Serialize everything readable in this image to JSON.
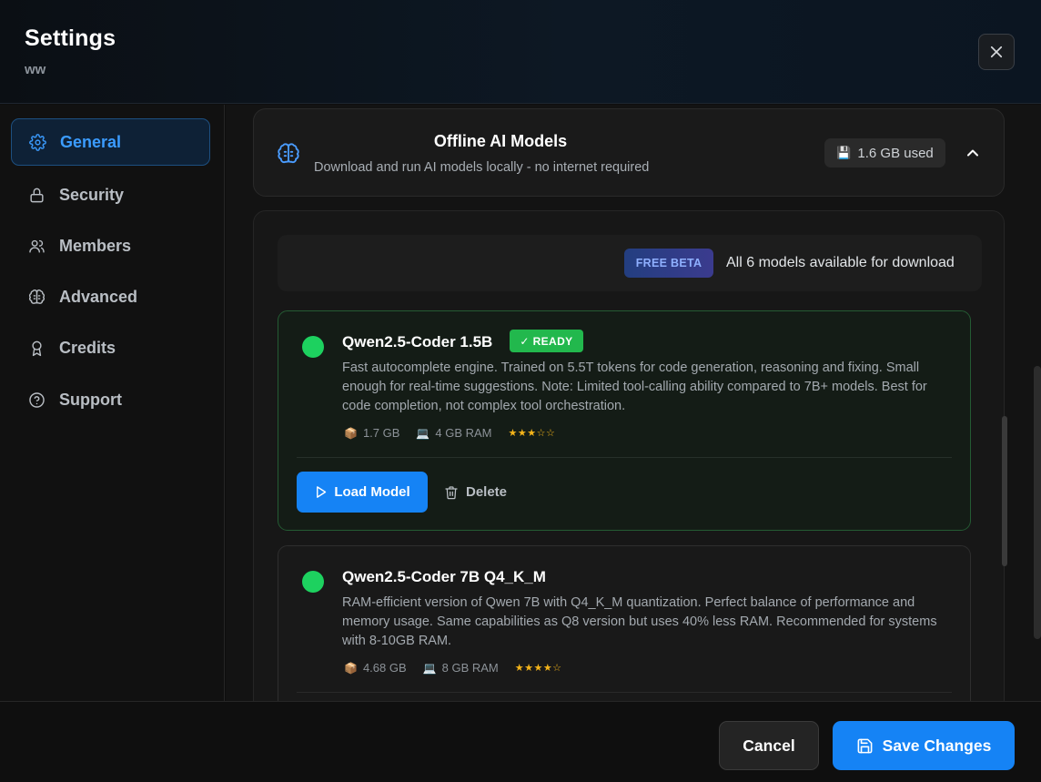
{
  "header": {
    "title": "Settings",
    "subtitle": "ww"
  },
  "sidebar": {
    "items": [
      {
        "label": "General",
        "icon": "gear-icon",
        "active": true
      },
      {
        "label": "Security",
        "icon": "lock-icon",
        "active": false
      },
      {
        "label": "Members",
        "icon": "users-icon",
        "active": false
      },
      {
        "label": "Advanced",
        "icon": "brain-icon",
        "active": false
      },
      {
        "label": "Credits",
        "icon": "award-icon",
        "active": false
      },
      {
        "label": "Support",
        "icon": "help-circle-icon",
        "active": false
      }
    ]
  },
  "section": {
    "title": "Offline AI Models",
    "description": "Download and run AI models locally - no internet required",
    "usage": "1.6 GB used",
    "icon": "brain-icon"
  },
  "info_bar": {
    "badge": "FREE BETA",
    "text": "All 6 models available for download"
  },
  "models": [
    {
      "name": "Qwen2.5-Coder 1.5B",
      "status_badge": "✓ READY",
      "description": "Fast autocomplete engine. Trained on 5.5T tokens for code generation, reasoning and fixing. Small enough for real-time suggestions. Note: Limited tool-calling ability compared to 7B+ models. Best for code completion, not complex tool orchestration.",
      "size": "1.7 GB",
      "ram": "4 GB RAM",
      "stars": "★★★☆☆",
      "rating": 3,
      "load_label": "Load Model",
      "delete_label": "Delete"
    },
    {
      "name": "Qwen2.5-Coder 7B Q4_K_M",
      "description": "RAM-efficient version of Qwen 7B with Q4_K_M quantization. Perfect balance of performance and memory usage. Same capabilities as Q8 version but uses 40% less RAM. Recommended for systems with 8-10GB RAM.",
      "size": "4.68 GB",
      "ram": "8 GB RAM",
      "stars": "★★★★☆",
      "rating": 4
    }
  ],
  "footer": {
    "cancel_label": "Cancel",
    "save_label": "Save Changes"
  },
  "colors": {
    "accent": "#1583f5",
    "ready": "#22b84d",
    "status_dot": "#1dd15f",
    "star": "#f4b41a"
  }
}
